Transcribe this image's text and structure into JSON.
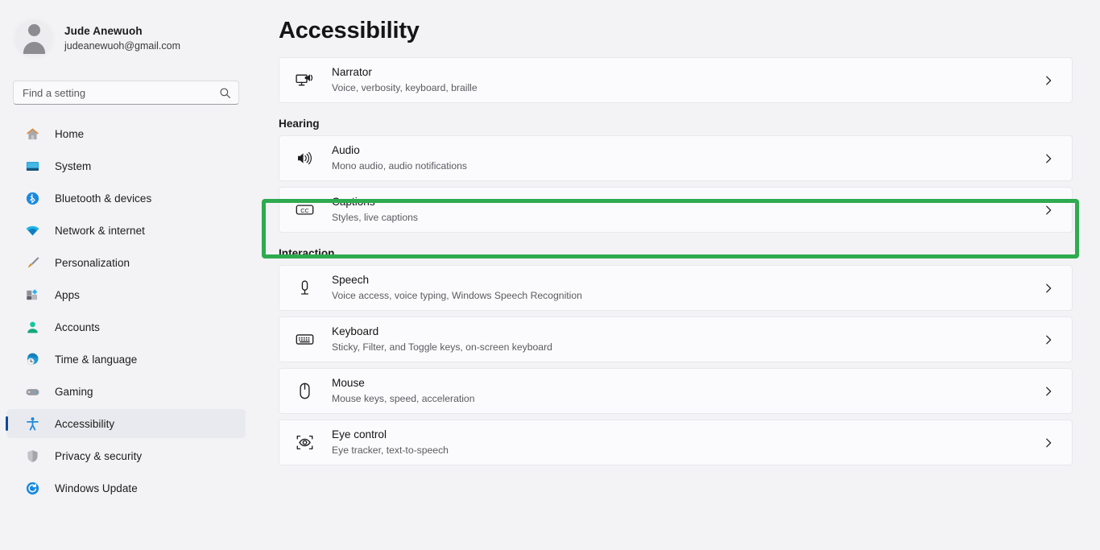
{
  "profile": {
    "name": "Jude Anewuoh",
    "email": "judeanewuoh@gmail.com",
    "avatar_icon": "person-avatar-icon"
  },
  "search": {
    "placeholder": "Find a setting",
    "value": "",
    "icon": "search-icon"
  },
  "sidebar": {
    "items": [
      {
        "label": "Home",
        "icon": "home-icon",
        "selected": false
      },
      {
        "label": "System",
        "icon": "system-monitor-icon",
        "selected": false
      },
      {
        "label": "Bluetooth & devices",
        "icon": "bluetooth-icon",
        "selected": false
      },
      {
        "label": "Network & internet",
        "icon": "wifi-icon",
        "selected": false
      },
      {
        "label": "Personalization",
        "icon": "paintbrush-icon",
        "selected": false
      },
      {
        "label": "Apps",
        "icon": "apps-icon",
        "selected": false
      },
      {
        "label": "Accounts",
        "icon": "person-icon",
        "selected": false
      },
      {
        "label": "Time & language",
        "icon": "clock-globe-icon",
        "selected": false
      },
      {
        "label": "Gaming",
        "icon": "gamepad-icon",
        "selected": false
      },
      {
        "label": "Accessibility",
        "icon": "accessibility-person-icon",
        "selected": true
      },
      {
        "label": "Privacy & security",
        "icon": "shield-icon",
        "selected": false
      },
      {
        "label": "Windows Update",
        "icon": "update-refresh-icon",
        "selected": false
      }
    ]
  },
  "main": {
    "title": "Accessibility",
    "groups": [
      {
        "heading": "",
        "cards": [
          {
            "title": "Narrator",
            "subtitle": "Voice, verbosity, keyboard, braille",
            "icon": "narrator-monitor-icon",
            "chevron": "chevron-right-icon",
            "highlighted": false
          }
        ]
      },
      {
        "heading": "Hearing",
        "cards": [
          {
            "title": "Audio",
            "subtitle": "Mono audio, audio notifications",
            "icon": "speaker-icon",
            "chevron": "chevron-right-icon",
            "highlighted": false
          },
          {
            "title": "Captions",
            "subtitle": "Styles, live captions",
            "icon": "closed-caption-icon",
            "chevron": "chevron-right-icon",
            "highlighted": true
          }
        ]
      },
      {
        "heading": "Interaction",
        "cards": [
          {
            "title": "Speech",
            "subtitle": "Voice access, voice typing, Windows Speech Recognition",
            "icon": "microphone-icon",
            "chevron": "chevron-right-icon",
            "highlighted": false
          },
          {
            "title": "Keyboard",
            "subtitle": "Sticky, Filter, and Toggle keys, on-screen keyboard",
            "icon": "keyboard-icon",
            "chevron": "chevron-right-icon",
            "highlighted": false
          },
          {
            "title": "Mouse",
            "subtitle": "Mouse keys, speed, acceleration",
            "icon": "mouse-icon",
            "chevron": "chevron-right-icon",
            "highlighted": false
          },
          {
            "title": "Eye control",
            "subtitle": "Eye tracker, text-to-speech",
            "icon": "eye-control-icon",
            "chevron": "chevron-right-icon",
            "highlighted": false
          }
        ]
      }
    ]
  },
  "annotation": {
    "target": "Captions",
    "color": "#2eab4f",
    "shape": "rectangle-outline"
  },
  "colors": {
    "page_background": "#f3f3f6",
    "card_background": "#fbfbfd",
    "accent_selection": "#0a4c9c",
    "selection_background": "#e9eaef",
    "highlight_green": "#2eab4f"
  }
}
